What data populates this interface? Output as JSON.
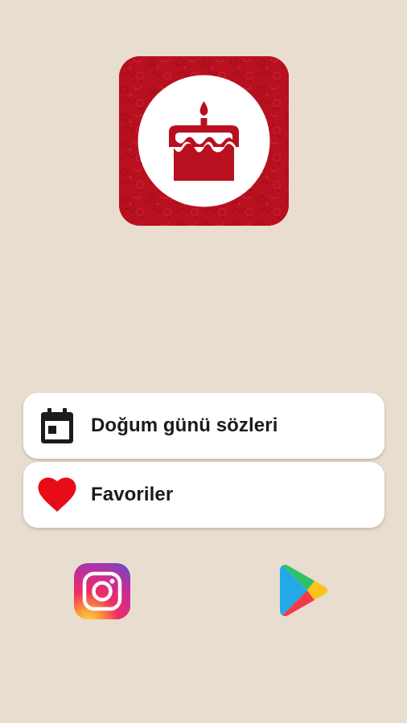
{
  "logo": {
    "icon": "birthday-cake-icon",
    "background_color": "#b8101f"
  },
  "menu": {
    "items": [
      {
        "label": "Doğum günü sözleri",
        "icon": "calendar-icon"
      },
      {
        "label": "Favoriler",
        "icon": "heart-icon",
        "icon_color": "#e80c18"
      }
    ]
  },
  "social": {
    "instagram_icon": "instagram-icon",
    "play_store_icon": "google-play-icon"
  }
}
